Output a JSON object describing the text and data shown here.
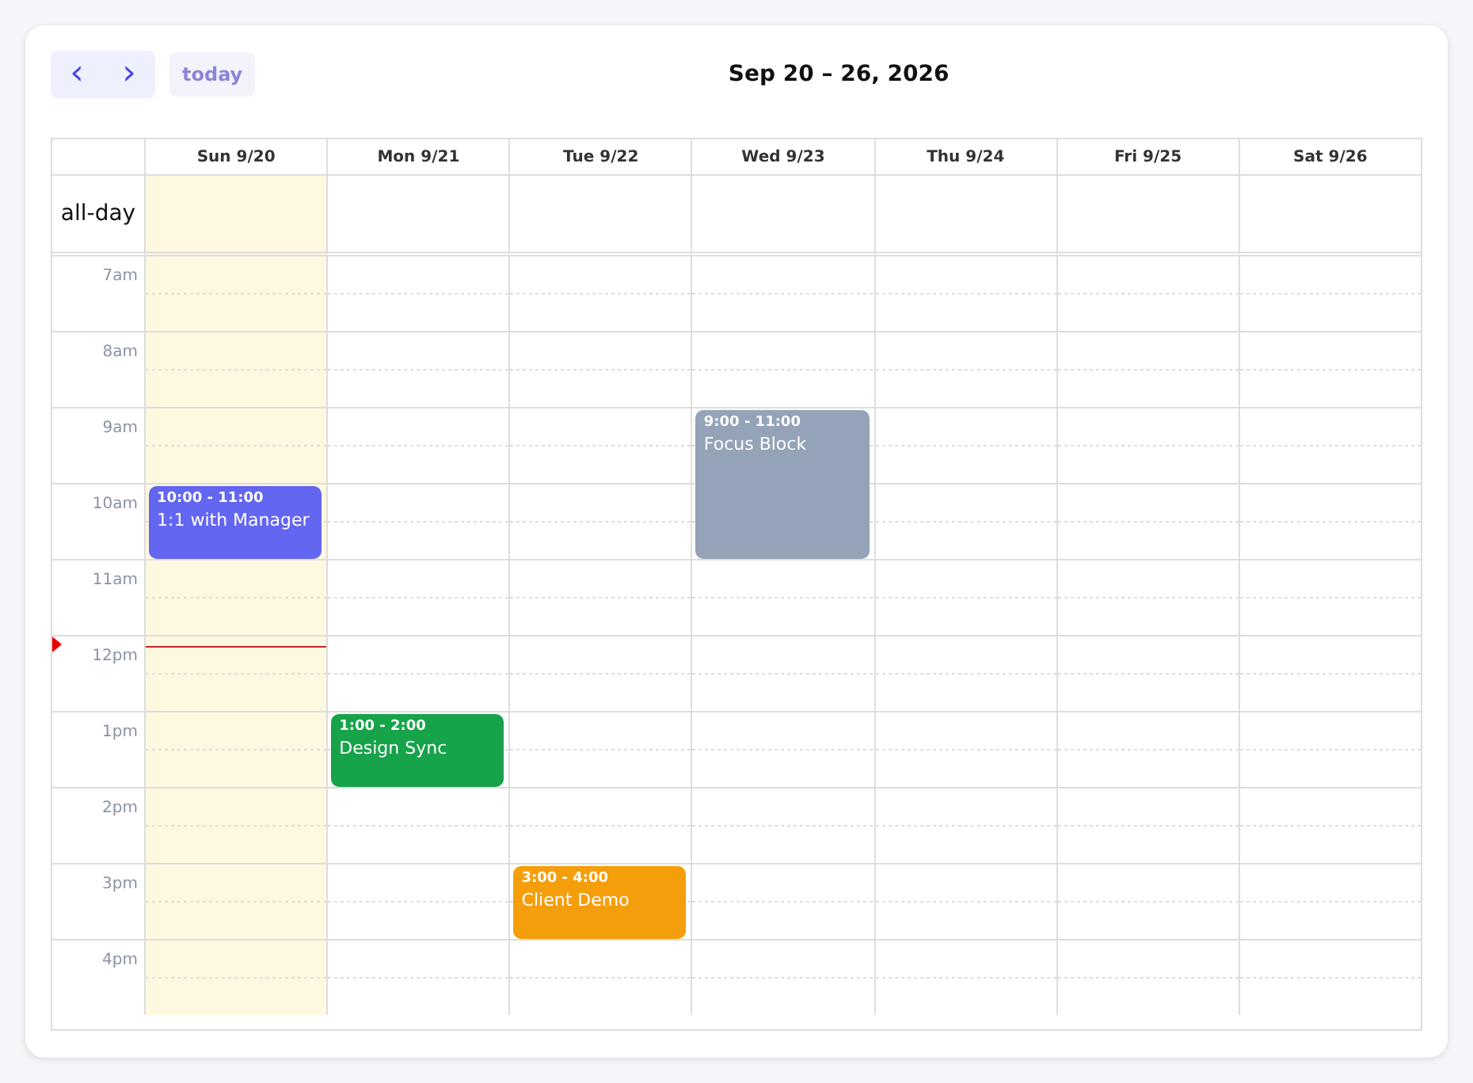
{
  "toolbar": {
    "prev": "‹",
    "next": "›",
    "today_button": "today",
    "title": "Sep 20 – 26, 2026"
  },
  "days": [
    {
      "label": "Sun 9/20",
      "today": true
    },
    {
      "label": "Mon 9/21",
      "today": false
    },
    {
      "label": "Tue 9/22",
      "today": false
    },
    {
      "label": "Wed 9/23",
      "today": false
    },
    {
      "label": "Thu 9/24",
      "today": false
    },
    {
      "label": "Fri 9/25",
      "today": false
    },
    {
      "label": "Sat 9/26",
      "today": false
    }
  ],
  "all_day_label": "all-day",
  "rows": [
    {
      "label": "7am",
      "now": false,
      "cells": [
        null,
        null,
        null,
        null,
        null,
        null,
        null
      ]
    },
    {
      "label": "8am",
      "now": false,
      "cells": [
        null,
        null,
        null,
        null,
        null,
        null,
        null
      ]
    },
    {
      "label": "9am",
      "now": false,
      "cells": [
        null,
        null,
        null,
        {
          "time": "9:00 - 11:00",
          "title": "Focus Block",
          "color": "#94a3b8",
          "kind": "double"
        },
        null,
        null,
        null
      ]
    },
    {
      "label": "10am",
      "now": false,
      "cells": [
        {
          "time": "10:00 - 11:00",
          "title": "1:1 with Manager",
          "color": "#6366f1",
          "kind": "single"
        },
        null,
        null,
        null,
        null,
        null,
        null
      ]
    },
    {
      "label": "11am",
      "now": false,
      "cells": [
        null,
        null,
        null,
        null,
        null,
        null,
        null
      ]
    },
    {
      "label": "12pm",
      "now": true,
      "cells": [
        null,
        null,
        null,
        null,
        null,
        null,
        null
      ]
    },
    {
      "label": "1pm",
      "now": false,
      "cells": [
        null,
        {
          "time": "1:00 - 2:00",
          "title": "Design Sync",
          "color": "#16a34a",
          "kind": "single"
        },
        null,
        null,
        null,
        null,
        null
      ]
    },
    {
      "label": "2pm",
      "now": false,
      "cells": [
        null,
        null,
        null,
        null,
        null,
        null,
        null
      ]
    },
    {
      "label": "3pm",
      "now": false,
      "cells": [
        null,
        null,
        {
          "time": "3:00 - 4:00",
          "title": "Client Demo",
          "color": "#f59e0b",
          "kind": "single"
        },
        null,
        null,
        null,
        null
      ]
    },
    {
      "label": "4pm",
      "now": false,
      "cells": [
        null,
        null,
        null,
        null,
        null,
        null,
        null
      ]
    }
  ]
}
